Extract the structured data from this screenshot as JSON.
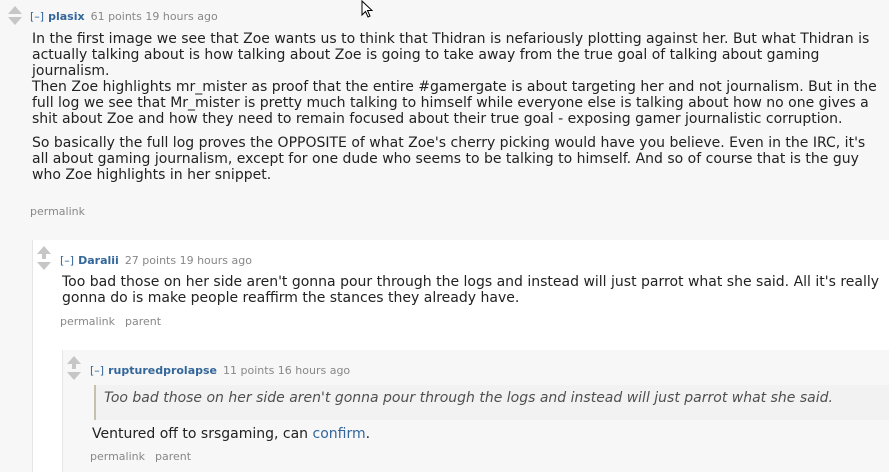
{
  "comments": [
    {
      "author": "plasix",
      "points": "61 points",
      "time": "19 hours ago",
      "toggle": "[–]",
      "paragraphs": [
        "In the first image we see that Zoe wants us to think that Thidran is nefariously plotting against her. But what Thidran is actually talking about is how talking about Zoe is going to take away from the true goal of talking about gaming journalism.",
        "Then Zoe highlights mr_mister as proof that the entire #gamergate is about targeting her and not journalism. But in the full log we see that Mr_mister is pretty much talking to himself while everyone else is talking about how no one gives a shit about Zoe and how they need to remain focused about their true goal - exposing gamer journalistic corruption.",
        "So basically the full log proves the OPPOSITE of what Zoe's cherry picking would have you believe. Even in the IRC, it's all about gaming journalism, except for one dude who seems to be talking to himself. And so of course that is the guy who Zoe highlights in her snippet."
      ],
      "links": [
        "permalink"
      ]
    },
    {
      "author": "Daralii",
      "points": "27 points",
      "time": "19 hours ago",
      "toggle": "[–]",
      "text": "Too bad those on her side aren't gonna pour through the logs and instead will just parrot what she said. All it's really gonna do is make people reaffirm the stances they already have.",
      "links": [
        "permalink",
        "parent"
      ]
    },
    {
      "author": "rupturedprolapse",
      "points": "11 points",
      "time": "16 hours ago",
      "toggle": "[–]",
      "quote": "Too bad those on her side aren't gonna pour through the logs and instead will just parrot what she said.",
      "text_before": "Ventured off to srsgaming, can ",
      "link_text": "confirm",
      "text_after": ".",
      "links": [
        "permalink",
        "parent"
      ]
    }
  ],
  "colors": {
    "link": "#336699",
    "meta": "#888888",
    "arrow": "#c6c6c6"
  }
}
